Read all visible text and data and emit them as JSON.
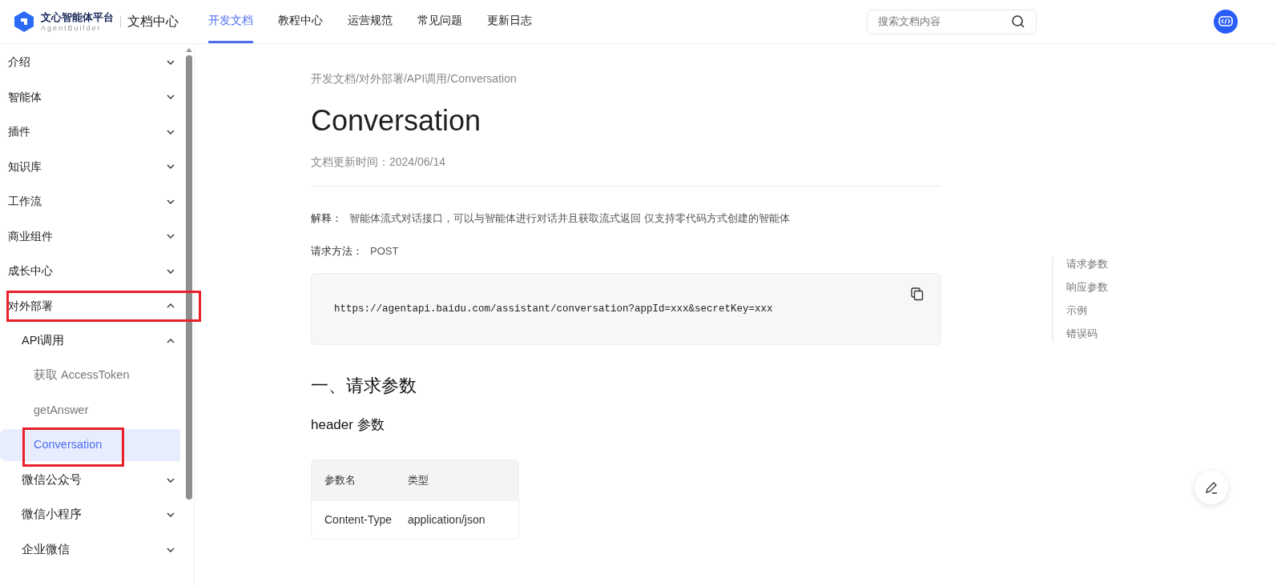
{
  "header": {
    "logo_title": "文心智能体平台",
    "logo_subtitle": "AgentBuilder",
    "section_title": "文档中心",
    "nav": [
      {
        "label": "开发文档",
        "selected": true
      },
      {
        "label": "教程中心",
        "selected": false
      },
      {
        "label": "运营规范",
        "selected": false
      },
      {
        "label": "常见问题",
        "selected": false
      },
      {
        "label": "更新日志",
        "selected": false
      }
    ],
    "search": {
      "placeholder": "搜索文档内容"
    }
  },
  "sidebar": {
    "items": [
      {
        "kind": "group",
        "label": "介绍",
        "expanded": false,
        "selected": false,
        "annotated": false
      },
      {
        "kind": "group",
        "label": "智能体",
        "expanded": false,
        "selected": false,
        "annotated": false
      },
      {
        "kind": "group",
        "label": "插件",
        "expanded": false,
        "selected": false,
        "annotated": false
      },
      {
        "kind": "group",
        "label": "知识库",
        "expanded": false,
        "selected": false,
        "annotated": false
      },
      {
        "kind": "group",
        "label": "工作流",
        "expanded": false,
        "selected": false,
        "annotated": false
      },
      {
        "kind": "group",
        "label": "商业组件",
        "expanded": false,
        "selected": false,
        "annotated": false
      },
      {
        "kind": "group",
        "label": "成长中心",
        "expanded": false,
        "selected": false,
        "annotated": false
      },
      {
        "kind": "group",
        "label": "对外部署",
        "expanded": true,
        "selected": false,
        "annotated": true,
        "children": [
          {
            "kind": "group",
            "label": "API调用",
            "expanded": true,
            "selected": false,
            "annotated": false,
            "children": [
              {
                "kind": "page",
                "label": "获取 AccessToken",
                "selected": false,
                "annotated": false
              },
              {
                "kind": "page",
                "label": "getAnswer",
                "selected": false,
                "annotated": false
              },
              {
                "kind": "page",
                "label": "Conversation",
                "selected": true,
                "annotated": true
              }
            ]
          },
          {
            "kind": "group",
            "label": "微信公众号",
            "expanded": false,
            "selected": false,
            "annotated": false
          },
          {
            "kind": "group",
            "label": "微信小程序",
            "expanded": false,
            "selected": false,
            "annotated": false
          },
          {
            "kind": "group",
            "label": "企业微信",
            "expanded": false,
            "selected": false,
            "annotated": false
          }
        ]
      }
    ]
  },
  "article": {
    "breadcrumb": "开发文档/对外部署/API调用/Conversation",
    "title": "Conversation",
    "updated": "文档更新时间：2024/06/14",
    "fields": [
      {
        "label": "解释：",
        "value": "智能体流式对话接口，可以与智能体进行对话并且获取流式返回 仅支持零代码方式创建的智能体"
      },
      {
        "label": "请求方法：",
        "value": "POST"
      }
    ],
    "code": "https://agentapi.baidu.com/assistant/conversation?appId=xxx&secretKey=xxx",
    "section_heading": "一、请求参数",
    "sub_heading": "header 参数",
    "table": {
      "columns": [
        "参数名",
        "类型"
      ],
      "rows": [
        [
          "Content-Type",
          "application/json"
        ]
      ]
    }
  },
  "toc": [
    {
      "label": "请求参数"
    },
    {
      "label": "响应参数"
    },
    {
      "label": "示例"
    },
    {
      "label": "错误码"
    }
  ]
}
